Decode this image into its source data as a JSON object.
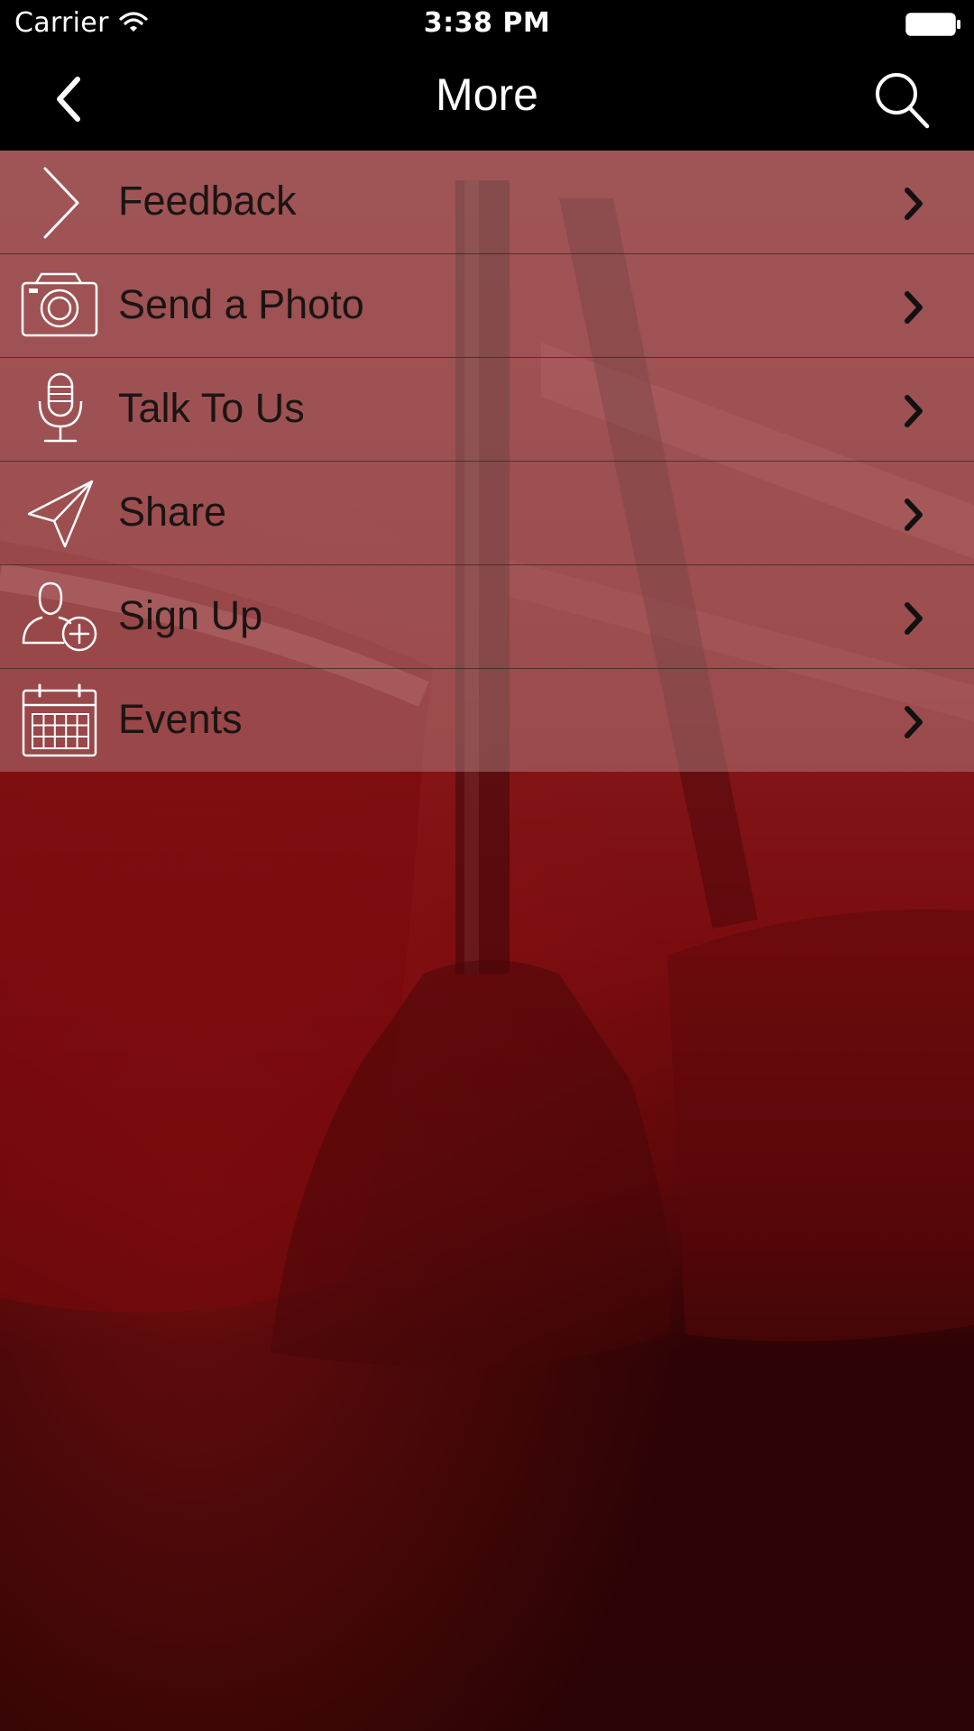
{
  "status_bar": {
    "carrier": "Carrier",
    "time": "3:38 PM"
  },
  "nav": {
    "title": "More",
    "back_icon": "back-chevron-icon",
    "search_icon": "search-icon"
  },
  "menu": {
    "items": [
      {
        "label": "Feedback",
        "icon": "feedback-chevron-icon"
      },
      {
        "label": "Send a Photo",
        "icon": "camera-icon"
      },
      {
        "label": "Talk To Us",
        "icon": "microphone-icon"
      },
      {
        "label": "Share",
        "icon": "paper-plane-icon"
      },
      {
        "label": "Sign Up",
        "icon": "add-user-icon"
      },
      {
        "label": "Events",
        "icon": "calendar-icon"
      }
    ]
  },
  "colors": {
    "bar_background": "#000000",
    "menu_text": "#1c1414",
    "background_red": "#7a0c0f",
    "background_dark": "#2a0304"
  }
}
